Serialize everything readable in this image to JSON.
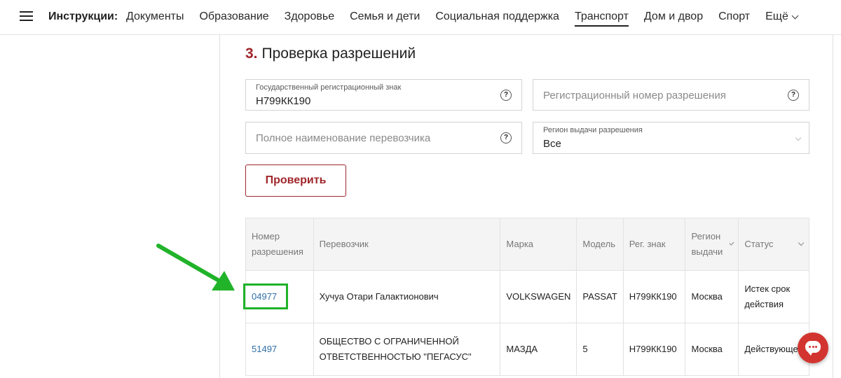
{
  "nav": {
    "title": "Инструкции:",
    "items": [
      "Документы",
      "Образование",
      "Здоровье",
      "Семья и дети",
      "Социальная поддержка",
      "Транспорт",
      "Дом и двор",
      "Спорт"
    ],
    "active": "Транспорт",
    "more": "Ещё"
  },
  "section": {
    "number": "3.",
    "title": "Проверка разрешений"
  },
  "form": {
    "plate": {
      "label": "Государственный регистрационный знак",
      "value": "Н799КК190"
    },
    "permit_number": {
      "placeholder": "Регистрационный номер разрешения"
    },
    "carrier_name": {
      "placeholder": "Полное наименование перевозчика"
    },
    "region": {
      "label": "Регион выдачи разрешения",
      "value": "Все"
    },
    "submit_label": "Проверить"
  },
  "table": {
    "headers": {
      "permit": "Номер разрешения",
      "carrier": "Перевозчик",
      "brand": "Марка",
      "model": "Модель",
      "plate": "Рег. знак",
      "region": "Регион выдачи",
      "status": "Статус"
    },
    "rows": [
      {
        "permit": "04977",
        "carrier": "Хучуа Отари Галактионович",
        "brand": "VOLKSWAGEN",
        "model": "PASSAT",
        "plate": "Н799КК190",
        "region": "Москва",
        "status": "Истек срок действия"
      },
      {
        "permit": "51497",
        "carrier": "ОБЩЕСТВО С ОГРАНИЧЕННОЙ ОТВЕТСТВЕННОСТЬЮ \"ПЕГАСУС\"",
        "brand": "МАЗДА",
        "model": "5",
        "plate": "Н799КК190",
        "region": "Москва",
        "status": "Действующее"
      }
    ]
  },
  "colors": {
    "accent": "#a0262b",
    "link": "#2f6fa8",
    "highlight": "#21b32a",
    "chat": "#d2352f"
  },
  "icons": {
    "menu": "hamburger-icon",
    "help": "question-icon",
    "chat": "chat-icon",
    "arrow": "arrow-icon"
  }
}
